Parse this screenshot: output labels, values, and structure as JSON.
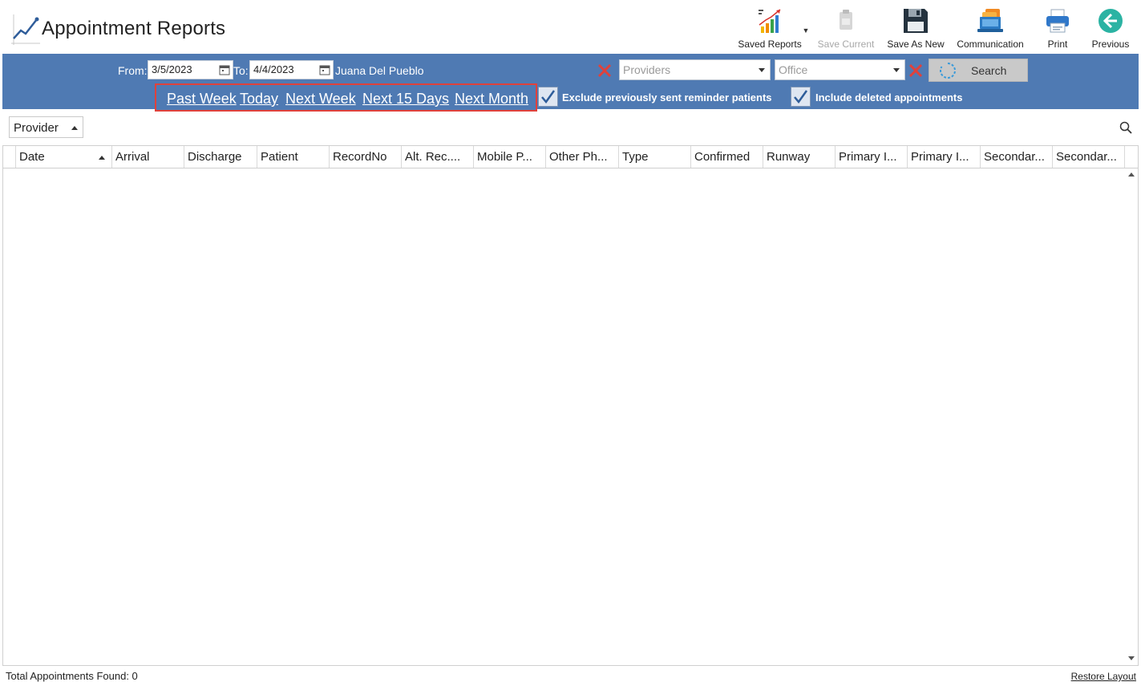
{
  "header": {
    "title": "Appointment Reports",
    "title_icon": "line-chart-icon"
  },
  "toolbar": {
    "saved_reports": {
      "label": "Saved Reports",
      "icon": "bar-chart-report-icon"
    },
    "save_current": {
      "label": "Save Current",
      "icon": "clipboard-icon",
      "disabled": true
    },
    "save_as_new": {
      "label": "Save As New",
      "icon": "floppy-disk-icon"
    },
    "communication": {
      "label": "Communication",
      "icon": "laptop-messages-icon"
    },
    "print": {
      "label": "Print",
      "icon": "printer-icon"
    },
    "previous": {
      "label": "Previous",
      "icon": "arrow-left-circle-icon"
    }
  },
  "filters": {
    "from_label": "From:",
    "from_value": "3/5/2023",
    "to_label": "To:",
    "to_value": "4/4/2023",
    "user_name": "Juana Del Pueblo",
    "providers_placeholder": "Providers",
    "office_placeholder": "Office",
    "search_label": "Search",
    "quick_ranges": [
      "Past Week",
      "Today",
      "Next Week",
      "Next 15 Days",
      "Next Month"
    ],
    "exclude_reminder": {
      "label": "Exclude previously sent reminder patients",
      "checked": true
    },
    "include_deleted": {
      "label": "Include deleted appointments",
      "checked": true
    }
  },
  "grouping": {
    "group_by": "Provider"
  },
  "grid": {
    "columns": [
      "Date",
      "Arrival",
      "Discharge",
      "Patient",
      "RecordNo",
      "Alt. Rec....",
      "Mobile P...",
      "Other Ph...",
      "Type",
      "Confirmed",
      "Runway",
      "Primary I...",
      "Primary I...",
      "Secondar...",
      "Secondar..."
    ],
    "sorted_column": "Date",
    "rows": []
  },
  "footer": {
    "status": "Total Appointments Found: 0",
    "restore_label": "Restore Layout"
  },
  "colors": {
    "band": "#4f7ab3",
    "highlight_border": "#e0413b",
    "clear_x": "#e0413b",
    "search_button": "#c9c9c9"
  }
}
